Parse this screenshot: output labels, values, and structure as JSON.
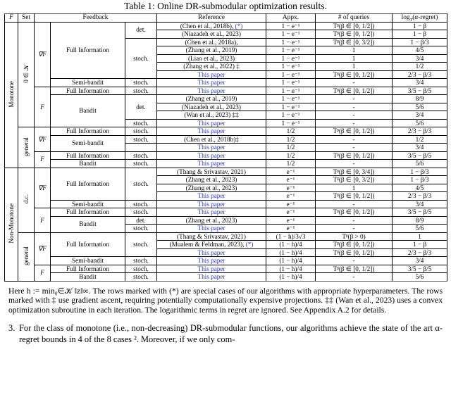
{
  "caption": "Table 1: Online DR-submodular optimization results.",
  "columns": [
    "F",
    "Set",
    "Feedback",
    "Reference",
    "Appx.",
    "# of queries",
    "log_T (α-regret)"
  ],
  "headers": {
    "f": "F",
    "set": "Set",
    "feedback": "Feedback",
    "reference": "Reference",
    "appx": "Appx.",
    "queries": "# of queries",
    "regret": "α-regret"
  },
  "groups": {
    "monotone": "Monotone",
    "non_monotone": "Non-Monotone",
    "set_zero_in_k": "0 ∈ 𝒦",
    "set_general": "general",
    "set_dc": "d.c.",
    "grad": "∇F",
    "plain": "F"
  },
  "labels": {
    "full_information": "Full Information",
    "semi_bandit": "Semi-bandit",
    "bandit": "Bandit",
    "det": "det.",
    "stoch": "stoch.",
    "this_paper": "This paper",
    "dash": "-"
  },
  "rows": [
    {
      "ref": "(Chen et al., 2018b), (*)",
      "star": true,
      "appx": "1 − e⁻¹",
      "q": "Tᵝ(β ∈ [0, 1/2])",
      "r": "1 − β",
      "fb": "det.",
      "paper": false
    },
    {
      "ref": "(Niazadeh et al., 2023)",
      "appx": "1 − e⁻¹",
      "q": "Tᵝ(β ∈ [0, 1/2])",
      "r": "1 − β",
      "paper": false
    },
    {
      "ref": "(Chen et al., 2018a),",
      "appx": "1 − e⁻¹",
      "q": "Tᵝ(β ∈ [0, 3/2])",
      "r": "1 − β/3",
      "fb": "stoch.",
      "paper": false
    },
    {
      "ref": "(Zhang et al., 2019)",
      "appx": "1 − e⁻¹",
      "q": "1",
      "r": "4/5",
      "paper": false
    },
    {
      "ref": "(Liao et al., 2023)",
      "appx": "1 − e⁻¹",
      "q": "1",
      "r": "3/4",
      "paper": false
    },
    {
      "ref": "(Zhang et al., 2022) ‡",
      "appx": "1 − e⁻¹",
      "q": "1",
      "r": "1/2",
      "paper": false
    },
    {
      "ref": "This paper",
      "appx": "1 − e⁻¹",
      "q": "Tᵝ(β ∈ [0, 1/2])",
      "r": "2/3 − β/3",
      "paper": true
    },
    {
      "ref": "This paper",
      "appx": "1 − e⁻¹",
      "q": "-",
      "r": "3/4",
      "paper": true
    },
    {
      "ref": "This paper",
      "appx": "1 − e⁻¹",
      "q": "Tᵝ(β ∈ [0, 1/2])",
      "r": "3/5 − β/5",
      "paper": true
    },
    {
      "ref": "(Zhang et al., 2019)",
      "appx": "1 − e⁻¹",
      "q": "-",
      "r": "8/9",
      "paper": false
    },
    {
      "ref": "(Niazadeh et al., 2023)",
      "appx": "1 − e⁻¹",
      "q": "-",
      "r": "5/6",
      "paper": false
    },
    {
      "ref": "(Wan et al., 2023) ‡‡",
      "appx": "1 − e⁻¹",
      "q": "-",
      "r": "3/4",
      "paper": false
    },
    {
      "ref": "This paper",
      "appx": "1 − e⁻¹",
      "q": "-",
      "r": "5/6",
      "paper": true
    },
    {
      "ref": "This paper",
      "appx": "1/2",
      "q": "Tᵝ(β ∈ [0, 1/2])",
      "r": "2/3 − β/3",
      "paper": true
    },
    {
      "ref": "(Chen et al., 2018b)‡",
      "appx": "1/2",
      "q": "-",
      "r": "1/2",
      "paper": false
    },
    {
      "ref": "This paper",
      "appx": "1/2",
      "q": "-",
      "r": "3/4",
      "paper": true
    },
    {
      "ref": "This paper",
      "appx": "1/2",
      "q": "Tᵝ(β ∈ [0, 1/2])",
      "r": "3/5 − β/5",
      "paper": true
    },
    {
      "ref": "This paper",
      "appx": "1/2",
      "q": "-",
      "r": "5/6",
      "paper": true
    },
    {
      "ref": "(Thang & Srivastav, 2021)",
      "appx": "e⁻¹",
      "q": "Tᵝ(β ∈ [0, 3/4])",
      "r": "1 − β/3",
      "paper": false
    },
    {
      "ref": "(Zhang et al., 2023)",
      "appx": "e⁻¹",
      "q": "Tᵝ(β ∈ [0, 3/2])",
      "r": "1 − β/3",
      "paper": false
    },
    {
      "ref": "(Zhang et al., 2023)",
      "appx": "e⁻¹",
      "q": "1",
      "r": "4/5",
      "paper": false
    },
    {
      "ref": "This paper",
      "appx": "e⁻¹",
      "q": "Tᵝ(β ∈ [0, 1/2])",
      "r": "2/3 − β/3",
      "paper": true
    },
    {
      "ref": "This paper",
      "appx": "e⁻¹",
      "q": "-",
      "r": "3/4",
      "paper": true
    },
    {
      "ref": "This paper",
      "appx": "e⁻¹",
      "q": "Tᵝ(β ∈ [0, 1/2])",
      "r": "3/5 − β/5",
      "paper": true
    },
    {
      "ref": "(Zhang et al., 2023)",
      "appx": "e⁻¹",
      "q": "-",
      "r": "8/9",
      "paper": false
    },
    {
      "ref": "This paper",
      "appx": "e⁻¹",
      "q": "-",
      "r": "5/6",
      "paper": true
    },
    {
      "ref": "(Thang & Srivastav, 2021)",
      "appx": "(1 − h)/3√3",
      "q": "Tᵝ(β > 0)",
      "r": "1",
      "paper": false
    },
    {
      "ref": "(Mualem & Feldman, 2023), (*)",
      "appx": "(1 − h)/4",
      "q": "Tᵝ(β ∈ [0, 1/2])",
      "r": "1 − β",
      "paper": false
    },
    {
      "ref": "This paper",
      "appx": "(1 − h)/4",
      "q": "Tᵝ(β ∈ [0, 1/2])",
      "r": "2/3 − β/3",
      "paper": true
    },
    {
      "ref": "This paper",
      "appx": "(1 − h)/4",
      "q": "-",
      "r": "3/4",
      "paper": true
    },
    {
      "ref": "This paper",
      "appx": "(1 − h)/4",
      "q": "Tᵝ(β ∈ [0, 1/2])",
      "r": "3/5 − β/5",
      "paper": true
    },
    {
      "ref": "This paper",
      "appx": "(1 − h)/4",
      "q": "-",
      "r": "5/6",
      "paper": true
    }
  ],
  "footnote": "Here h := min₀∈𝒦 ‖z‖∞. The rows marked with (*) are special cases of our algorithms with appropriate hyperparameters. The rows marked with ‡ use gradient ascent, requiring potentially computationally expensive projections. ‡‡ (Wan et al., 2023) uses a convex optimization subroutine in each iteration. The logarithmic terms in regret are ignored. See Appendix A.2 for details.",
  "body_item": {
    "number": "3.",
    "text": "For the class of monotone (i.e., non-decreasing) DR-submodular functions, our algorithms achieve the state of the art α-regret bounds in 4 of the 8 cases ². Moreover, if we only com-"
  },
  "colors": {
    "link_blue": "#2a34cf",
    "text": "#000000",
    "rule": "#555555"
  }
}
